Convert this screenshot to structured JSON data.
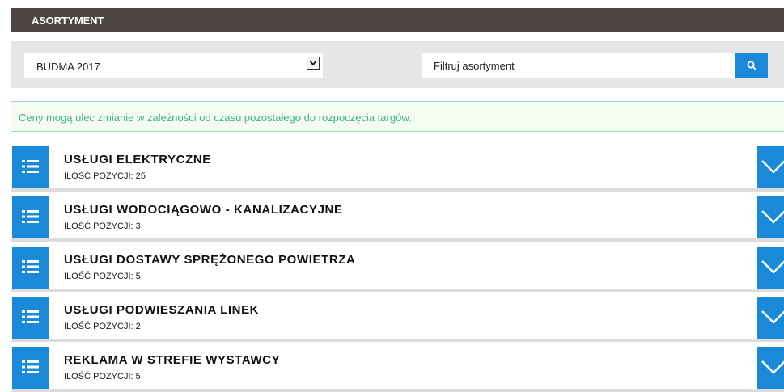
{
  "header": {
    "title": "ASORTYMENT"
  },
  "filters": {
    "event_select_value": "BUDMA 2017",
    "search_placeholder": "Filtruj asortyment"
  },
  "notice": {
    "text": "Ceny mogą ulec zmianie w zależności od czasu pozostałego do rozpoczęcia targów."
  },
  "categories": [
    {
      "title": "USŁUGI ELEKTRYCZNE",
      "count": "ILOŚĆ POZYCJI: 25"
    },
    {
      "title": "USŁUGI WODOCIĄGOWO - KANALIZACYJNE",
      "count": "ILOŚĆ POZYCJI: 3"
    },
    {
      "title": "USŁUGI DOSTAWY SPRĘŻONEGO POWIETRZA",
      "count": "ILOŚĆ POZYCJI: 5"
    },
    {
      "title": "USŁUGI PODWIESZANIA LINEK",
      "count": "ILOŚĆ POZYCJI: 2"
    },
    {
      "title": "REKLAMA W STREFIE WYSTAWCY",
      "count": "ILOŚĆ POZYCJI: 5"
    }
  ],
  "colors": {
    "accent": "#1a8ad8",
    "header_bg": "#4d4642",
    "notice_text": "#3bb58e"
  },
  "icons": {
    "category": "list-icon",
    "toggle": "chevron-down-icon",
    "search": "search-icon"
  }
}
